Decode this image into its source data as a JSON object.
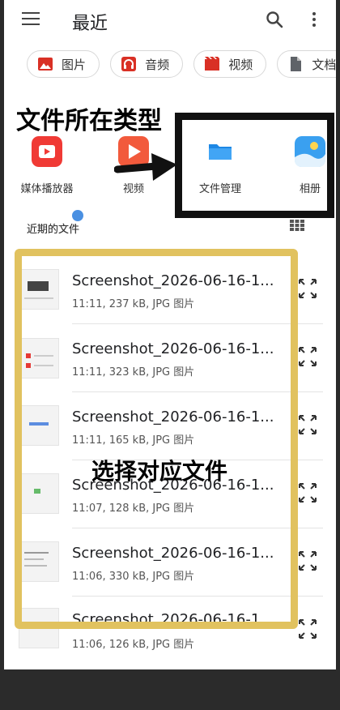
{
  "app": {
    "title": "最近"
  },
  "chips": [
    {
      "label": "图片",
      "icon": "image-icon",
      "color": "#d93025"
    },
    {
      "label": "音频",
      "icon": "headphones-icon",
      "color": "#d93025"
    },
    {
      "label": "视频",
      "icon": "movie-icon",
      "color": "#d93025"
    },
    {
      "label": "文档",
      "icon": "document-icon",
      "color": "#555555"
    }
  ],
  "annotations": {
    "top": "文件所在类型",
    "middle": "选择对应文件"
  },
  "apps": [
    {
      "label": "媒体播放器",
      "icon": "media-player-icon"
    },
    {
      "label": "视频",
      "icon": "video-icon"
    },
    {
      "label": "文件管理",
      "icon": "folder-icon"
    },
    {
      "label": "相册",
      "icon": "gallery-icon"
    }
  ],
  "recent": {
    "label": "近期的文件"
  },
  "files": [
    {
      "name": "Screenshot_2026-06-16-1...",
      "meta": "11:11, 237 kB, JPG 图片"
    },
    {
      "name": "Screenshot_2026-06-16-1...",
      "meta": "11:11, 323 kB, JPG 图片"
    },
    {
      "name": "Screenshot_2026-06-16-1...",
      "meta": "11:11, 165 kB, JPG 图片"
    },
    {
      "name": "Screenshot_2026-06-16-1...",
      "meta": "11:07, 128 kB, JPG 图片"
    },
    {
      "name": "Screenshot_2026-06-16-1...",
      "meta": "11:06, 330 kB, JPG 图片"
    },
    {
      "name": "Screenshot_2026-06-16-1...",
      "meta": "11:06, 126 kB, JPG 图片"
    }
  ],
  "colors": {
    "annotation_box_dark": "#111111",
    "annotation_box_yellow": "#e1c25f",
    "accent_red": "#d93025",
    "folder_blue": "#1e88e5"
  }
}
